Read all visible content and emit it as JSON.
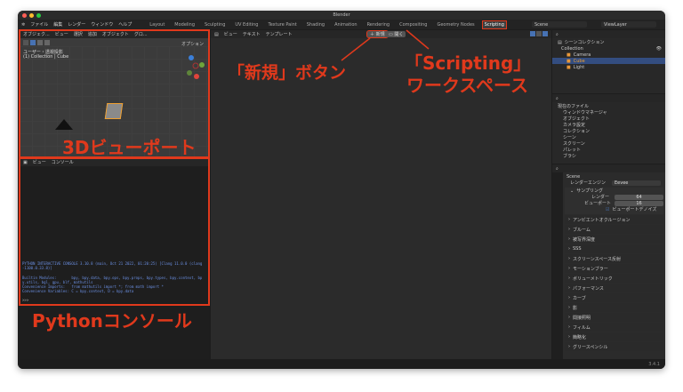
{
  "window": {
    "title": "Blender"
  },
  "menu": {
    "items": [
      "ファイル",
      "編集",
      "レンダー",
      "ウィンドウ",
      "ヘルプ"
    ]
  },
  "workspaces": [
    "Layout",
    "Modeling",
    "Sculpting",
    "UV Editing",
    "Texture Paint",
    "Shading",
    "Animation",
    "Rendering",
    "Compositing",
    "Geometry Nodes",
    "Scripting"
  ],
  "scene": "Scene",
  "view_layer": "ViewLayer",
  "viewport": {
    "header": [
      "オブジェク...",
      "ビュー",
      "選択",
      "追加",
      "オブジェクト",
      "グロ..."
    ],
    "options": "オプション",
    "view_name": "ユーザー・透視投影",
    "collection_info": "(1) Collection | Cube"
  },
  "text_editor": {
    "header": [
      "ビュー",
      "テキスト",
      "テンプレート"
    ],
    "new": "新規",
    "open": "開く"
  },
  "console": {
    "header": [
      "ビュー",
      "コンソール"
    ],
    "lines": [
      "PYTHON INTERACTIVE CONSOLE 3.10.8 (main, Oct 21 2022, 01:20:25) [Clang 11.0.0 (clang",
      "-1100.0.33.8)]",
      "",
      "Builtin Modules:       bpy, bpy.data, bpy.ops, bpy.props, bpy.types, bpy.context, bp",
      "y.utils, bgl, gpu, blf, mathutils",
      "Convenience Imports:   from mathutils import *; from math import *",
      "Convenience Variables: C = bpy.context, D = bpy.data"
    ],
    "prompt": ">>>"
  },
  "outliner": {
    "root": "シーンコレクション",
    "items": [
      "Collection",
      "Camera",
      "Cube",
      "Light"
    ]
  },
  "data_browser": {
    "root": "現在のファイル",
    "items": [
      "ウィンドウマネージャ",
      "オブジェクト",
      "カメラ設定",
      "コレクション",
      "シーン",
      "スクリーン",
      "パレット",
      "ブラシ"
    ]
  },
  "properties": {
    "scene": "Scene",
    "engine_label": "レンダーエンジン",
    "engine": "Eevee",
    "sampling": "サンプリング",
    "render_label": "レンダー",
    "render_value": "64",
    "viewport_label": "ビューポート",
    "viewport_value": "16",
    "denoise": "ビューポートデノイズ",
    "panels": [
      "アンビエントオクルージョン",
      "ブルーム",
      "被写界深度",
      "SSS",
      "スクリーンスペース反射",
      "モーションブラー",
      "ボリューメトリック",
      "パフォーマンス",
      "カーブ",
      "影",
      "間接照明",
      "フィルム",
      "簡略化",
      "グリースペンシル"
    ]
  },
  "status": {
    "version": "3.4.1"
  },
  "annotations": {
    "new_button": "「新規」ボタン",
    "scripting1": "「Scripting」",
    "scripting2": "ワークスペース",
    "viewport": "3Dビューポート",
    "console": "Pythonコンソール"
  },
  "colors": {
    "accent": "#e0391c",
    "selection": "#334d80"
  }
}
